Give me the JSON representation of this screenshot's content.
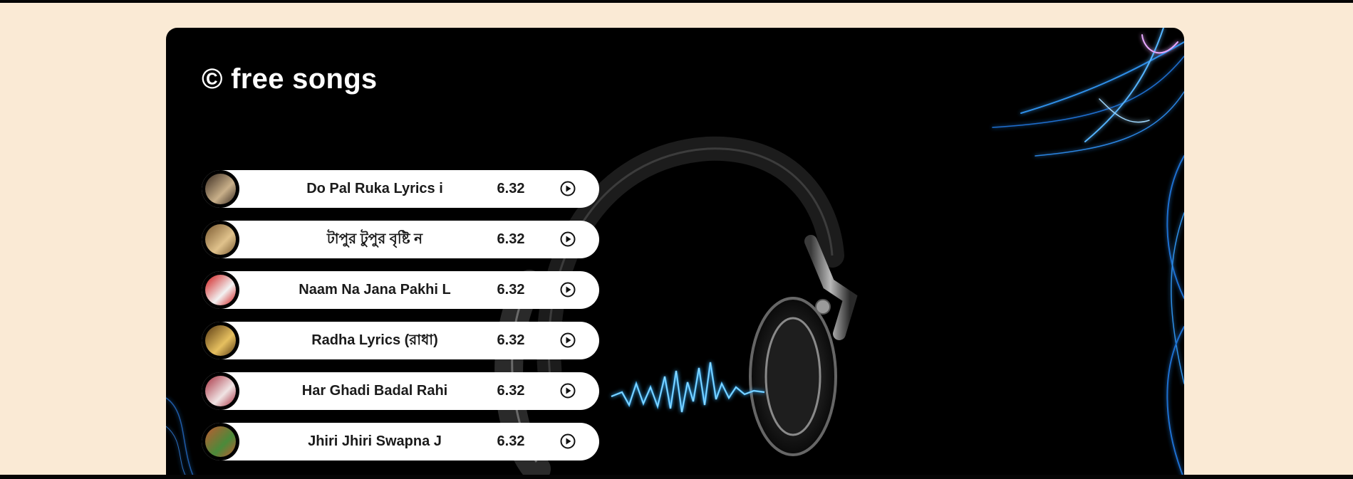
{
  "header": {
    "title": "© free songs"
  },
  "songs": [
    {
      "title": "Do Pal Ruka Lyrics i",
      "size": "6.32",
      "thumb_colors": [
        "#3a2b20",
        "#c9b08a"
      ]
    },
    {
      "title": "টাপুর টুপুর বৃষ্টি ন",
      "size": "6.32",
      "thumb_colors": [
        "#7a5a30",
        "#e0c28c"
      ]
    },
    {
      "title": "Naam Na Jana Pakhi L",
      "size": "6.32",
      "thumb_colors": [
        "#d01818",
        "#f2f2f2"
      ]
    },
    {
      "title": "Radha Lyrics (রাধা)",
      "size": "6.32",
      "thumb_colors": [
        "#5a3a12",
        "#e6c060"
      ]
    },
    {
      "title": "Har Ghadi Badal Rahi",
      "size": "6.32",
      "thumb_colors": [
        "#a83040",
        "#f0e4e4"
      ]
    },
    {
      "title": "Jhiri Jhiri Swapna J",
      "size": "6.32",
      "thumb_colors": [
        "#c05a30",
        "#4a8a3a"
      ]
    }
  ],
  "colors": {
    "page_background": "#faead5",
    "card_background": "#000000",
    "row_background": "#ffffff",
    "accent_glow": "#2fa8ff"
  }
}
